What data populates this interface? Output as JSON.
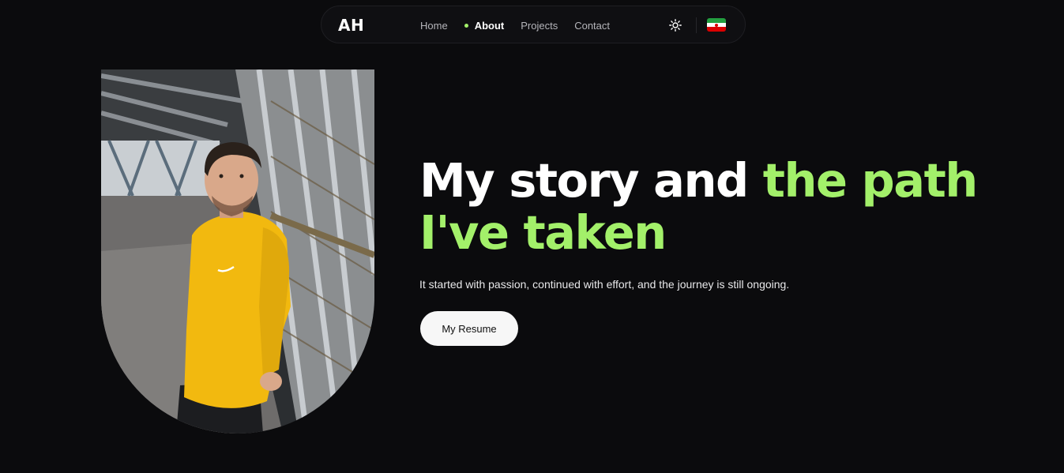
{
  "nav": {
    "logo": "AH",
    "links": [
      {
        "label": "Home",
        "active": false
      },
      {
        "label": "About",
        "active": true
      },
      {
        "label": "Projects",
        "active": false
      },
      {
        "label": "Contact",
        "active": false
      }
    ],
    "theme_icon": "sun-icon",
    "language_icon": "iran-flag-icon"
  },
  "hero": {
    "title_plain": "My story and ",
    "title_accent": "the path I've taken",
    "subtitle": "It started with passion, continued with effort, and the journey is still ongoing.",
    "cta_label": "My Resume"
  },
  "colors": {
    "background": "#0b0b0d",
    "accent": "#a3f06a",
    "button_bg": "#f7f7f7",
    "sweater": "#f2b90f"
  }
}
